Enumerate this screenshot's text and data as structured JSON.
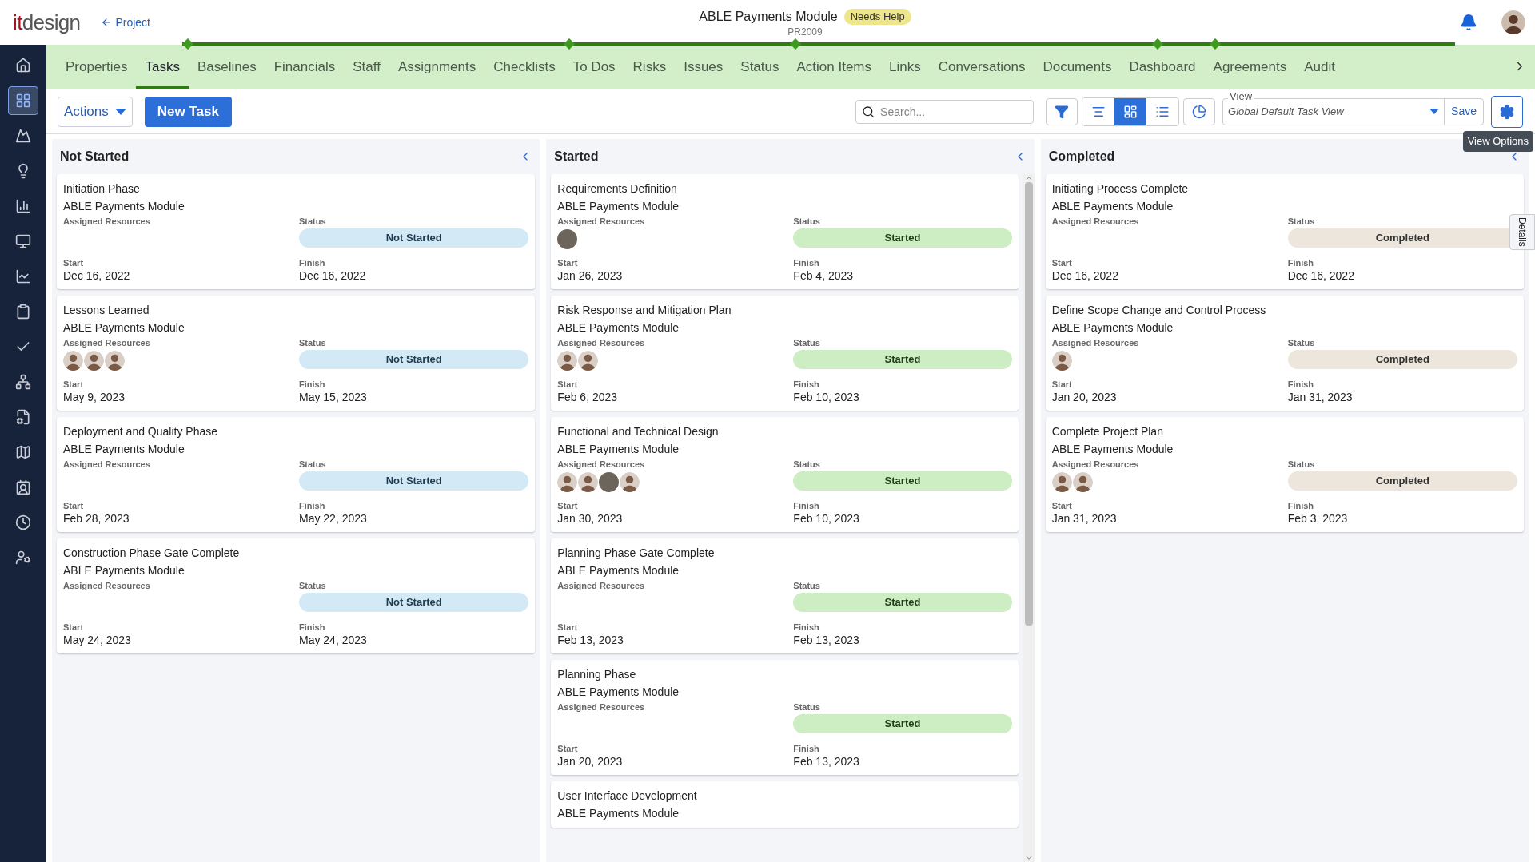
{
  "header": {
    "logo": [
      "it",
      "design"
    ],
    "back_link": "Project",
    "title": "ABLE Payments Module",
    "badge": "Needs Help",
    "code": "PR2009"
  },
  "sidebar": {
    "items": [
      {
        "selected": false
      },
      {
        "selected": true
      },
      {
        "selected": false
      },
      {
        "selected": false
      },
      {
        "selected": false
      },
      {
        "selected": false
      },
      {
        "selected": false
      },
      {
        "selected": false
      },
      {
        "selected": false
      },
      {
        "selected": false
      },
      {
        "selected": false
      },
      {
        "selected": false
      },
      {
        "selected": false
      },
      {
        "selected": false
      },
      {
        "selected": false
      }
    ]
  },
  "tabs": [
    {
      "label": "Properties",
      "selected": false
    },
    {
      "label": "Tasks",
      "selected": true
    },
    {
      "label": "Baselines",
      "selected": false
    },
    {
      "label": "Financials",
      "selected": false
    },
    {
      "label": "Staff",
      "selected": false
    },
    {
      "label": "Assignments",
      "selected": false
    },
    {
      "label": "Checklists",
      "selected": false
    },
    {
      "label": "To Dos",
      "selected": false
    },
    {
      "label": "Risks",
      "selected": false
    },
    {
      "label": "Issues",
      "selected": false
    },
    {
      "label": "Status",
      "selected": false
    },
    {
      "label": "Action Items",
      "selected": false
    },
    {
      "label": "Links",
      "selected": false
    },
    {
      "label": "Conversations",
      "selected": false
    },
    {
      "label": "Documents",
      "selected": false
    },
    {
      "label": "Dashboard",
      "selected": false
    },
    {
      "label": "Agreements",
      "selected": false
    },
    {
      "label": "Audit",
      "selected": false
    }
  ],
  "toolbar": {
    "actions": "Actions",
    "new_task": "New Task",
    "search": {
      "placeholder": "Search..."
    },
    "view_modes": [
      {
        "kind": "gantt",
        "selected": false
      },
      {
        "kind": "board",
        "selected": true
      },
      {
        "kind": "list",
        "selected": false
      }
    ],
    "view": {
      "label": "View",
      "value": "Global Default Task View",
      "save": "Save"
    },
    "tooltip": "View Options"
  },
  "details_tab": "Details",
  "columns": [
    {
      "title": "Not Started",
      "scrollbar": false,
      "cards": [
        {
          "title": "Initiation Phase",
          "project": "ABLE Payments Module",
          "resources_label": "Assigned Resources",
          "status_label": "Status",
          "status": {
            "label": "Not Started",
            "kind": "not_started"
          },
          "start_label": "Start",
          "start": "Dec 16, 2022",
          "finish_label": "Finish",
          "finish": "Dec 16, 2022"
        },
        {
          "title": "Lessons Learned",
          "project": "ABLE Payments Module",
          "resources_label": "Assigned Resources",
          "resources": [
            {
              "kind": "photo"
            },
            {
              "kind": "photo"
            },
            {
              "kind": "photo"
            }
          ],
          "status_label": "Status",
          "status": {
            "label": "Not Started",
            "kind": "not_started"
          },
          "start_label": "Start",
          "start": "May 9, 2023",
          "finish_label": "Finish",
          "finish": "May 15, 2023"
        },
        {
          "title": "Deployment and Quality Phase",
          "project": "ABLE Payments Module",
          "resources_label": "Assigned Resources",
          "status_label": "Status",
          "status": {
            "label": "Not Started",
            "kind": "not_started"
          },
          "start_label": "Start",
          "start": "Feb 28, 2023",
          "finish_label": "Finish",
          "finish": "May 22, 2023"
        },
        {
          "title": "Construction Phase Gate Complete",
          "project": "ABLE Payments Module",
          "resources_label": "Assigned Resources",
          "status_label": "Status",
          "status": {
            "label": "Not Started",
            "kind": "not_started"
          },
          "start_label": "Start",
          "start": "May 24, 2023",
          "finish_label": "Finish",
          "finish": "May 24, 2023"
        }
      ]
    },
    {
      "title": "Started",
      "scrollbar": true,
      "cards": [
        {
          "title": "Requirements Definition",
          "project": "ABLE Payments Module",
          "resources_label": "Assigned Resources",
          "resources": [
            {
              "kind": "blank"
            }
          ],
          "status_label": "Status",
          "status": {
            "label": "Started",
            "kind": "started"
          },
          "start_label": "Start",
          "start": "Jan 26, 2023",
          "finish_label": "Finish",
          "finish": "Feb 4, 2023"
        },
        {
          "title": "Risk Response and Mitigation Plan",
          "project": "ABLE Payments Module",
          "resources_label": "Assigned Resources",
          "resources": [
            {
              "kind": "photo"
            },
            {
              "kind": "photo"
            }
          ],
          "status_label": "Status",
          "status": {
            "label": "Started",
            "kind": "started"
          },
          "start_label": "Start",
          "start": "Feb 6, 2023",
          "finish_label": "Finish",
          "finish": "Feb 10, 2023"
        },
        {
          "title": "Functional and Technical Design",
          "project": "ABLE Payments Module",
          "resources_label": "Assigned Resources",
          "resources": [
            {
              "kind": "photo"
            },
            {
              "kind": "photo"
            },
            {
              "kind": "blank"
            },
            {
              "kind": "photo"
            }
          ],
          "status_label": "Status",
          "status": {
            "label": "Started",
            "kind": "started"
          },
          "start_label": "Start",
          "start": "Jan 30, 2023",
          "finish_label": "Finish",
          "finish": "Feb 10, 2023"
        },
        {
          "title": "Planning Phase Gate Complete",
          "project": "ABLE Payments Module",
          "resources_label": "Assigned Resources",
          "status_label": "Status",
          "status": {
            "label": "Started",
            "kind": "started"
          },
          "start_label": "Start",
          "start": "Feb 13, 2023",
          "finish_label": "Finish",
          "finish": "Feb 13, 2023"
        },
        {
          "title": "Planning Phase",
          "project": "ABLE Payments Module",
          "resources_label": "Assigned Resources",
          "status_label": "Status",
          "status": {
            "label": "Started",
            "kind": "started"
          },
          "start_label": "Start",
          "start": "Jan 20, 2023",
          "finish_label": "Finish",
          "finish": "Feb 13, 2023"
        },
        {
          "title": "User Interface Development",
          "project": "ABLE Payments Module"
        }
      ]
    },
    {
      "title": "Completed",
      "scrollbar": false,
      "cards": [
        {
          "title": "Initiating Process Complete",
          "project": "ABLE Payments Module",
          "resources_label": "Assigned Resources",
          "status_label": "Status",
          "status": {
            "label": "Completed",
            "kind": "completed"
          },
          "start_label": "Start",
          "start": "Dec 16, 2022",
          "finish_label": "Finish",
          "finish": "Dec 16, 2022"
        },
        {
          "title": "Define Scope Change and Control Process",
          "project": "ABLE Payments Module",
          "resources_label": "Assigned Resources",
          "resources": [
            {
              "kind": "photo"
            }
          ],
          "status_label": "Status",
          "status": {
            "label": "Completed",
            "kind": "completed"
          },
          "start_label": "Start",
          "start": "Jan 20, 2023",
          "finish_label": "Finish",
          "finish": "Jan 31, 2023"
        },
        {
          "title": "Complete Project Plan",
          "project": "ABLE Payments Module",
          "resources_label": "Assigned Resources",
          "resources": [
            {
              "kind": "photo"
            },
            {
              "kind": "photo"
            }
          ],
          "status_label": "Status",
          "status": {
            "label": "Completed",
            "kind": "completed"
          },
          "start_label": "Start",
          "start": "Jan 31, 2023",
          "finish_label": "Finish",
          "finish": "Feb 3, 2023"
        }
      ]
    }
  ]
}
